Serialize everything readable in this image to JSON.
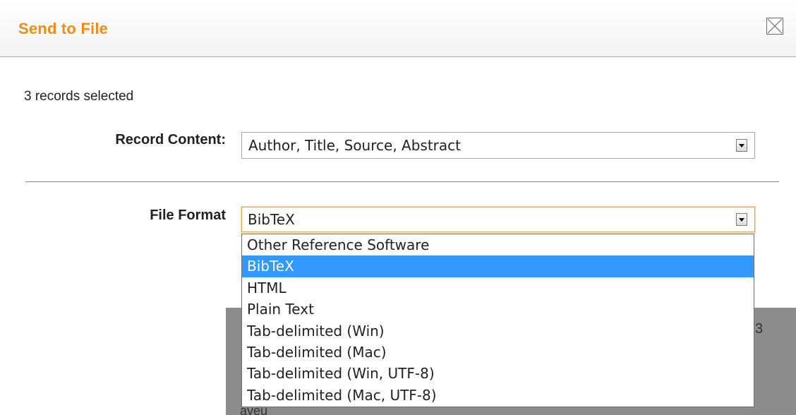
{
  "dialog": {
    "title": "Send to File",
    "title_color": "#f08c1a",
    "close_icon": "close-x-icon"
  },
  "records_selected": "3 records selected",
  "record_content": {
    "label": "Record Content:",
    "value": "Author, Title, Source, Abstract"
  },
  "file_format": {
    "label": "File Format",
    "value": "BibTeX",
    "options": [
      "Other Reference Software",
      "BibTeX",
      "HTML",
      "Plain Text",
      "Tab-delimited (Win)",
      "Tab-delimited (Mac)",
      "Tab-delimited (Win, UTF-8)",
      "Tab-delimited (Mac, UTF-8)"
    ],
    "selected_option": "BibTeX",
    "highlight_color": "#3399ff"
  },
  "underlay": {
    "partial_text_right": "3",
    "partial_text_bottom": "aveu"
  }
}
